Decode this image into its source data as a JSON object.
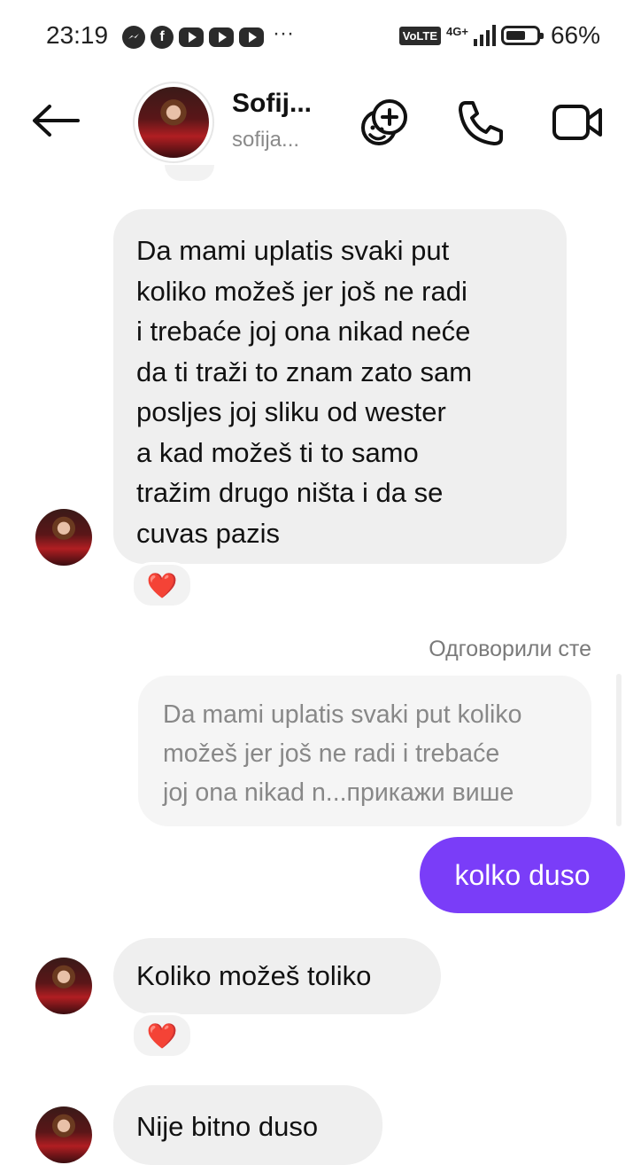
{
  "status_bar": {
    "time": "23:19",
    "volte": "VoLTE",
    "network": "4G+",
    "battery": "66%",
    "battery_level": 0.66,
    "app_icons": [
      "messenger-icon",
      "facebook-icon",
      "youtube-icon",
      "youtube-icon",
      "youtube-icon"
    ]
  },
  "header": {
    "contact_name": "Sofij...",
    "contact_handle": "sofija..."
  },
  "messages": [
    {
      "direction": "incoming",
      "lines": [
        "Da mami uplatis svaki put",
        "koliko možeš jer još ne radi",
        "i trebaće joj ona nikad neće",
        "da ti traži to znam zato sam",
        "posljes joj sliku od wester",
        "a kad možeš ti to samo",
        "tražim drugo ništa i da se",
        "cuvas pazis"
      ],
      "reaction": "❤️"
    },
    {
      "direction": "outgoing",
      "reply_label": "Одговорили сте",
      "quoted_lines": [
        "Da mami uplatis svaki put koliko",
        "možeš jer još ne radi i trebaće",
        "joj ona nikad n...прикажи више"
      ],
      "text": "kolko duso",
      "bubble_color": "#7a3df8"
    },
    {
      "direction": "incoming",
      "text": "Koliko možeš toliko",
      "reaction": "❤️"
    },
    {
      "direction": "incoming",
      "text": "Nije bitno duso"
    }
  ]
}
